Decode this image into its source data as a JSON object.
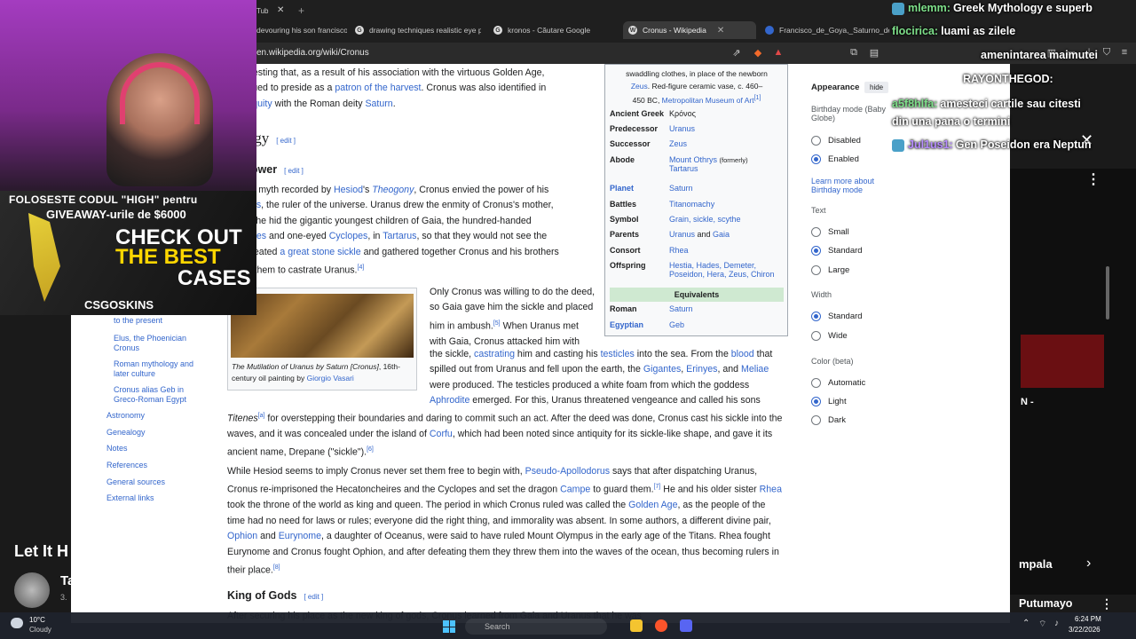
{
  "browser": {
    "top_tab_partial": "Tub",
    "tabs": [
      {
        "label": "devouring his son francisco"
      },
      {
        "label": "drawing techniques realistic eye p"
      },
      {
        "label": "kronos - Căutare Google"
      },
      {
        "label": "Cronus - Wikipedia",
        "active": true
      },
      {
        "label": "Francisco_de_Goya,_Saturno_devo"
      }
    ],
    "url": "en.wikipedia.org/wiki/Cronus"
  },
  "toc": {
    "items": [
      "to the present",
      "Elus, the Phoenician Cronus",
      "Roman mythology and later culture",
      "Cronus alias Geb in Greco-Roman Egypt",
      "Astronomy",
      "Genealogy",
      "Notes",
      "References",
      "General sources",
      "External links"
    ]
  },
  "article": {
    "intro": {
      "line1": ", suggesting that, as a result of his association with the virtuous Golden Age,",
      "line2a": "continued to preside as a ",
      "line2_link": "patron of the harvest",
      "line2b": ". Cronus was also identified in",
      "line3_link": "al antiquity",
      "line3a": " with the Roman deity ",
      "line3_link2": "Saturn",
      "line3b": "."
    },
    "heading_mythology": "hology",
    "subheading_power": "to power",
    "edit_label": "[ edit ]",
    "p1": {
      "a": "ncient myth recorded by ",
      "l1": "Hesiod",
      "b": "'s ",
      "l2": "Theogony",
      "c": ", Cronus envied the power of his",
      "d_l": "Uranus",
      "e": ", the ruler of the universe. Uranus drew the enmity of Cronus's mother,",
      "f": "when he hid the gigantic youngest children of Gaia, the hundred-handed",
      "g_l": "ncheires",
      "h": " and one-eyed ",
      "i_l": "Cyclopes",
      "j": ", in ",
      "k_l": "Tartarus",
      "m": ", so that they would not see the",
      "n": "aia created ",
      "o_l": "a great stone sickle",
      "p": " and gathered together Cronus and his brothers",
      "q": "uade them to castrate Uranus.",
      "q_sup": "[4]"
    },
    "p2": {
      "l1": "Only Cronus was willing to do the deed,",
      "l2": "so Gaia gave him the sickle and placed",
      "l3": "him in ambush.",
      "l3_sup": "[5]",
      "l3b": " When Uranus met",
      "l4": "with Gaia, Cronus attacked him with",
      "l5a": "the sickle, ",
      "l5_link1": "castrating",
      "l5b": " him and casting his ",
      "l5_link2": "testicles",
      "l5c": " into the sea. From the ",
      "l5_link3": "blood",
      "l5d": " that",
      "l6a": "spilled out from Uranus and fell upon the earth, the ",
      "l6_link1": "Gigantes",
      "l6b": ", ",
      "l6_link2": "Erinyes",
      "l6c": ", and ",
      "l6_link3": "Meliae",
      "l7": "were produced. The testicles produced a white foam from which the goddess",
      "l8_link": "Aphrodite",
      "l8": " emerged. For this, Uranus threatened vengeance and called his sons",
      "l9_italic": "Titenes",
      "l9_sup": "[a]",
      "l9": " for overstepping their boundaries and daring to commit such an act. After the deed was done, Cronus cast his sickle into the",
      "l10a": "waves, and it was concealed under the island of ",
      "l10_link": "Corfu",
      "l10b": ", which had been noted since antiquity for its sickle-like shape, and gave it its",
      "l11": "ancient name, Drepane (\"sickle\").",
      "l11_sup": "[6]"
    },
    "p3": {
      "l1a": "While Hesiod seems to imply Cronus never set them free to begin with, ",
      "l1_link": "Pseudo-Apollodorus",
      "l1b": " says that after dispatching Uranus,",
      "l2a": "Cronus re-imprisoned the Hecatoncheires and the Cyclopes and set the dragon ",
      "l2_link": "Campe",
      "l2b": " to guard them.",
      "l2_sup": "[7]",
      "l2c": " He and his older sister ",
      "l2_link2": "Rhea",
      "l3a": "took the throne of the world as king and queen. The period in which Cronus ruled was called the ",
      "l3_link": "Golden Age",
      "l3b": ", as the people of the",
      "l4": "time had no need for laws or rules; everyone did the right thing, and immorality was absent. In some authors, a different divine pair,",
      "l5_link1": "Ophion",
      "l5a": " and ",
      "l5_link2": "Eurynome",
      "l5b": ", a daughter of Oceanus, were said to have ruled Mount Olympus in the early age of the Titans. Rhea fought",
      "l6": "Eurynome and Cronus fought Ophion, and after defeating them they threw them into the waves of the ocean, thus becoming rulers in",
      "l7": "their place.",
      "l7_sup": "[8]"
    },
    "subheading_king": "King of Gods",
    "p4": "After securing his place as the new king of gods, Cronus learned from Gaia and Uranus that he was",
    "image_caption_italic": "The Mutilation of Uranus by Saturn [Cronus]",
    "image_caption_rest": ", 16th-century oil painting by ",
    "image_caption_link": "Giorgio Vasari"
  },
  "infobox": {
    "caption_l1": "swaddling clothes, in place of the newborn",
    "caption_l2_link": "Zeus",
    "caption_l2": ". Red-figure ceramic vase, c. 460–",
    "caption_l3": "450 BC, ",
    "caption_l3_link": "Metropolitan Museum of Art",
    "caption_l3_sup": "[1]",
    "rows": [
      {
        "label": "Ancient Greek",
        "value": "Κρόνος",
        "plain": true
      },
      {
        "label": "Predecessor",
        "value": "Uranus"
      },
      {
        "label": "Successor",
        "value": "Zeus"
      },
      {
        "label": "Abode",
        "value": "Mount Othrys",
        "note": "(formerly)",
        "value2": "Tartarus"
      },
      {
        "label": "Planet",
        "value": "Saturn",
        "label_link": true
      },
      {
        "label": "Battles",
        "value": "Titanomachy"
      },
      {
        "label": "Symbol",
        "value": "Grain, sickle, scythe"
      },
      {
        "label": "Parents",
        "value": "Uranus",
        "and": " and ",
        "value2": "Gaia"
      },
      {
        "label": "Consort",
        "value": "Rhea"
      },
      {
        "label": "Offspring",
        "value": "Hestia, Hades, Demeter,",
        "value2": "Poseidon, Hera, Zeus, Chiron"
      }
    ],
    "equivalents_title": "Equivalents",
    "equiv_rows": [
      {
        "label": "Roman",
        "value": "Saturn"
      },
      {
        "label": "Egyptian",
        "value": "Geb",
        "label_link": true
      }
    ]
  },
  "appearance": {
    "title": "Appearance",
    "hide": "hide",
    "birthday_title": "Birthday mode (Baby Globe)",
    "birthday_options": [
      "Disabled",
      "Enabled"
    ],
    "birthday_selected": "Enabled",
    "learn_more": "Learn more about Birthday mode",
    "text_title": "Text",
    "text_options": [
      "Small",
      "Standard",
      "Large"
    ],
    "text_selected": "Standard",
    "width_title": "Width",
    "width_options": [
      "Standard",
      "Wide"
    ],
    "width_selected": "Standard",
    "color_title": "Color (beta)",
    "color_options": [
      "Automatic",
      "Light",
      "Dark"
    ],
    "color_selected": "Light"
  },
  "stream": {
    "ad_line1": "FOLOSESTE CODUL \"HIGH\" pentru",
    "ad_line2": "GIVEAWAY-urile de $6000",
    "ad_line3": "CHECK OUT",
    "ad_line4": "THE BEST",
    "ad_line5": "CASES",
    "ad_brand": "CSGOSKINS"
  },
  "chat": [
    {
      "user": "mlemm:",
      "msg": "Greek Mythology e superb",
      "user_color": "#7ee08a"
    },
    {
      "user": "flocirica:",
      "msg": "luami as zilele",
      "user_color": "#7ee08a"
    },
    {
      "user": "",
      "msg": "amenintarea maimutei",
      "user_color": "#ffffff"
    },
    {
      "user": "RAYONTHEGOD:",
      "msg": "",
      "user_color": "#ffffff"
    },
    {
      "user": "a5f8hlfa:",
      "msg": "amesteci cartile sau citesti",
      "user_color": "#7ee08a"
    },
    {
      "user": "",
      "msg": "din una pana o termini",
      "user_color": "#ffffff"
    },
    {
      "user": "Jul1us1:",
      "msg": "Gen Poseidon era Neptun",
      "user_color": "#b68cff"
    }
  ],
  "youtube": {
    "dash": "N -",
    "song": "mpala",
    "channel": "Putumayo",
    "video_title_partial": "Let It H",
    "channel_partial": "Ta",
    "views_partial": "3."
  },
  "taskbar": {
    "temp": "10°C",
    "weather": "Cloudy",
    "search": "Search",
    "time": "6:24 PM",
    "date": "3/22/2026"
  }
}
